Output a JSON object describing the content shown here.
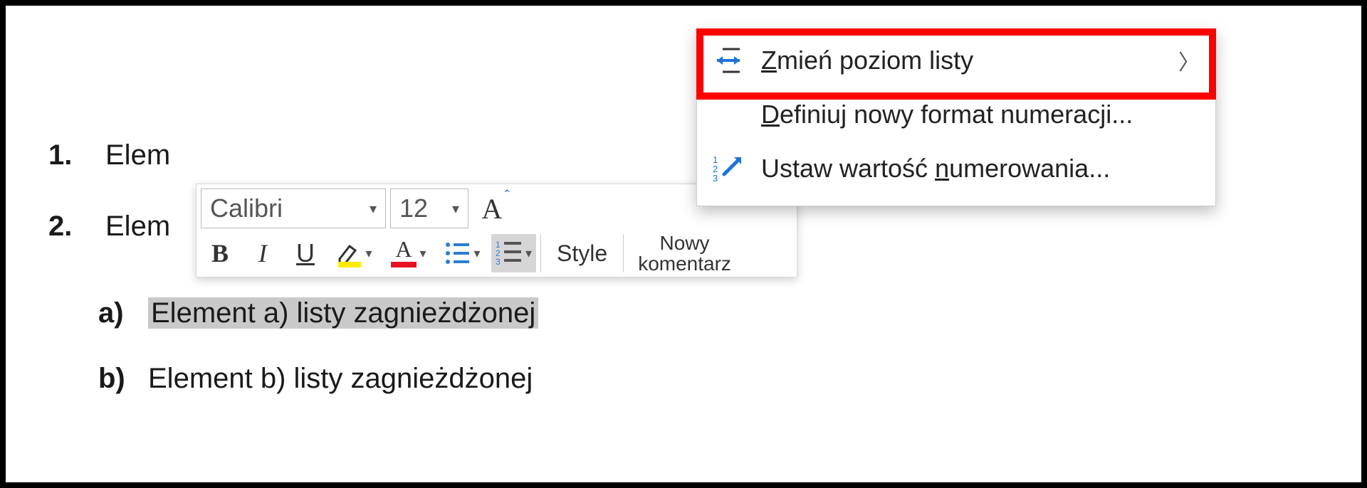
{
  "document": {
    "items": [
      {
        "marker": "1.",
        "text": "Elem"
      },
      {
        "marker": "2.",
        "text": "Elem"
      }
    ],
    "nested": [
      {
        "marker": "a)",
        "text": "Element a) listy zagnieżdżonej",
        "selected": true
      },
      {
        "marker": "b)",
        "text": "Element b) listy zagnieżdżonej",
        "selected": false
      }
    ]
  },
  "toolbar": {
    "font_name": "Calibri",
    "font_size": "12",
    "grow_font_glyph": "A",
    "bold": "B",
    "italic": "I",
    "underline": "U",
    "styles_label": "Style",
    "new_comment_line1": "Nowy",
    "new_comment_line2": "komentarz"
  },
  "menu": {
    "change_level_label": "mień poziom listy",
    "change_level_accel": "Z",
    "define_format_accel": "D",
    "define_format_label": "efiniuj nowy format numeracji...",
    "set_value_prefix": "Ustaw wartość ",
    "set_value_accel": "n",
    "set_value_suffix": "umerowania..."
  }
}
